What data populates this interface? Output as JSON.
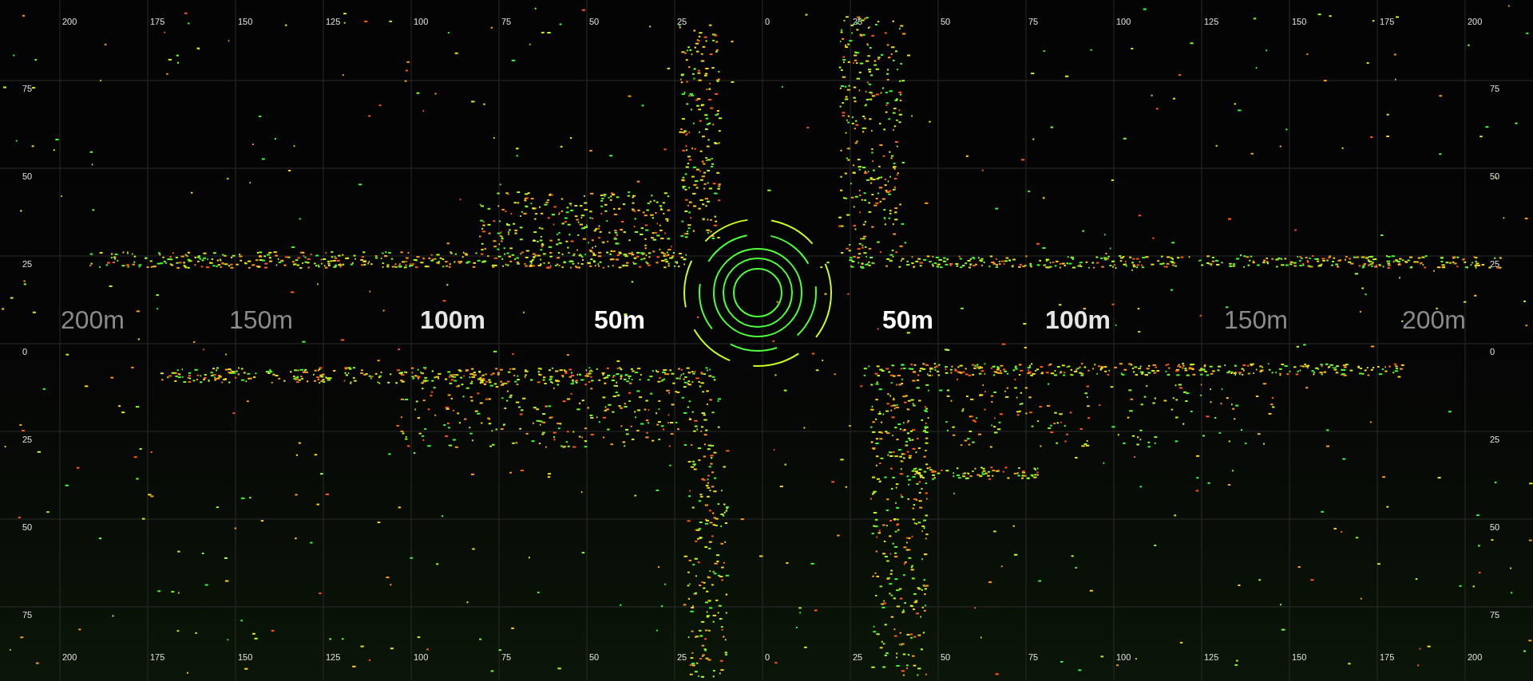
{
  "top_axis_labels": [
    "200",
    "175",
    "150",
    "125",
    "100",
    "75",
    "50",
    "25",
    "0",
    "25",
    "50",
    "75",
    "100",
    "125",
    "150",
    "175",
    "200"
  ],
  "bottom_axis_labels": [
    "200",
    "175",
    "150",
    "125",
    "100",
    "75",
    "50",
    "25",
    "0",
    "25",
    "50",
    "75",
    "100",
    "125",
    "150",
    "175",
    "200"
  ],
  "left_axis_labels": [
    "75",
    "50",
    "25",
    "0",
    "25",
    "50",
    "75"
  ],
  "right_axis_labels": [
    "75",
    "50",
    "25",
    "0",
    "25",
    "50",
    "75"
  ],
  "range_labels": [
    {
      "text": "200m",
      "kind": "far"
    },
    {
      "text": "150m",
      "kind": "far"
    },
    {
      "text": "100m",
      "kind": "mid"
    },
    {
      "text": "50m",
      "kind": "near"
    },
    {
      "text": "50m",
      "kind": "near"
    },
    {
      "text": "100m",
      "kind": "mid"
    },
    {
      "text": "150m",
      "kind": "far"
    },
    {
      "text": "200m",
      "kind": "far"
    }
  ]
}
